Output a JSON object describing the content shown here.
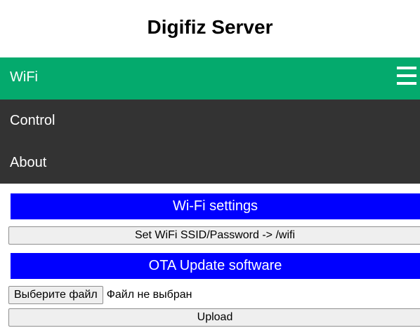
{
  "header": {
    "title": "Digifiz Server"
  },
  "nav": {
    "active_label": "WiFi",
    "menu_icon": "hamburger-menu-icon",
    "items": [
      {
        "label": "Control"
      },
      {
        "label": "About"
      }
    ]
  },
  "wifi_section": {
    "heading": "Wi-Fi settings",
    "button_label": "Set WiFi SSID/Password -> /wifi"
  },
  "ota_section": {
    "heading": "OTA Update software",
    "choose_file_label": "Выберите файл",
    "file_status": "Файл не выбран",
    "upload_label": "Upload"
  },
  "colors": {
    "nav_active": "#04aa6d",
    "nav_background": "#333333",
    "heading_bar": "#0000ff"
  }
}
